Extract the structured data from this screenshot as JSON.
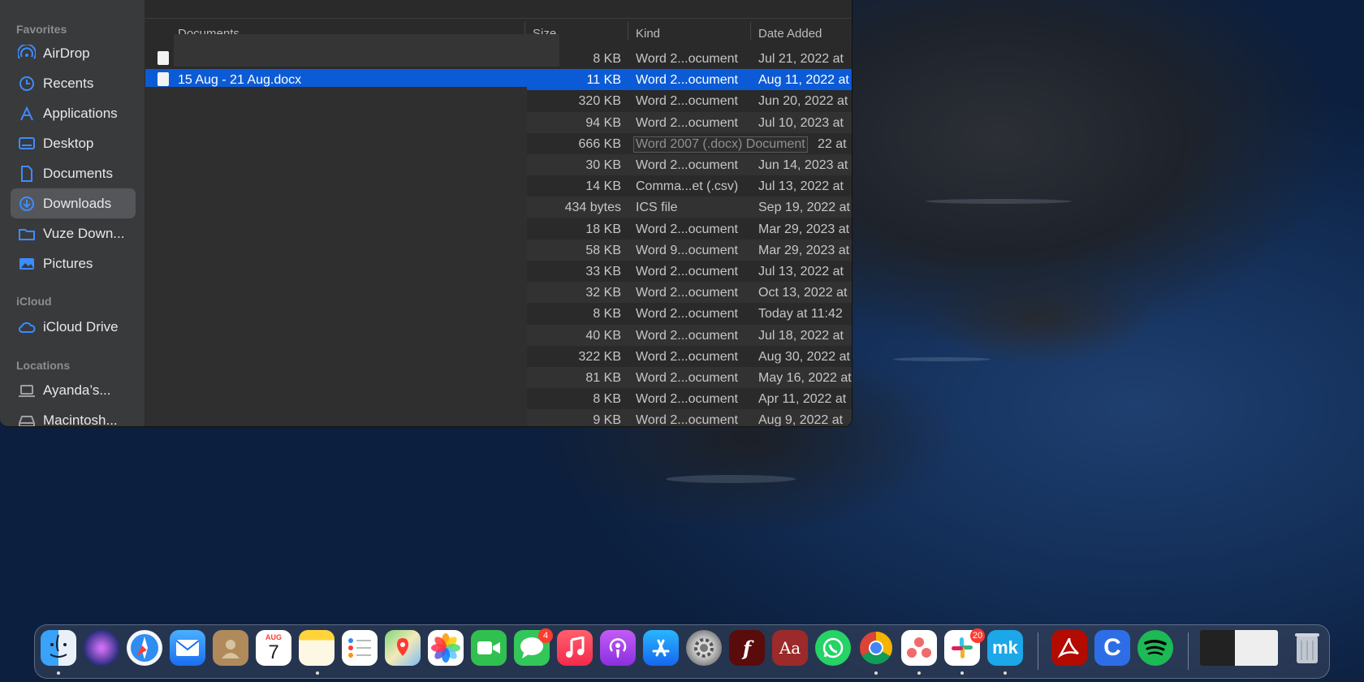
{
  "sidebar": {
    "sections": [
      "Favorites",
      "iCloud",
      "Locations"
    ],
    "favorites": [
      {
        "label": "AirDrop",
        "icon": "airdrop-icon"
      },
      {
        "label": "Recents",
        "icon": "clock-icon"
      },
      {
        "label": "Applications",
        "icon": "applications-icon"
      },
      {
        "label": "Desktop",
        "icon": "desktop-icon"
      },
      {
        "label": "Documents",
        "icon": "document-icon"
      },
      {
        "label": "Downloads",
        "icon": "download-icon",
        "active": true
      },
      {
        "label": "Vuze Down...",
        "icon": "folder-icon"
      },
      {
        "label": "Pictures",
        "icon": "pictures-icon"
      }
    ],
    "icloud": [
      {
        "label": "iCloud Drive",
        "icon": "cloud-icon"
      }
    ],
    "locations": [
      {
        "label": "Ayanda’s...",
        "icon": "laptop-icon"
      },
      {
        "label": "Macintosh...",
        "icon": "disk-icon"
      }
    ]
  },
  "columns": {
    "name": "Documents",
    "size": "Size",
    "kind": "Kind",
    "date": "Date Added"
  },
  "rows": [
    {
      "name": "",
      "size": "8 KB",
      "kind": "Word 2...ocument",
      "date": "Jul 21, 2022 at"
    },
    {
      "name": "15 Aug - 21 Aug.docx",
      "size": "11 KB",
      "kind": "Word 2...ocument",
      "date": "Aug 11, 2022 at",
      "selected": true
    },
    {
      "name": "",
      "size": "320 KB",
      "kind": "Word 2...ocument",
      "date": "Jun 20, 2022 at"
    },
    {
      "name": "",
      "size": "94 KB",
      "kind": "Word 2...ocument",
      "date": "Jul 10, 2023 at"
    },
    {
      "name": "",
      "size": "666 KB",
      "kind": "Word 2007 (.docx) Document",
      "date": "22 at",
      "editing": true
    },
    {
      "name": "",
      "size": "30 KB",
      "kind": "Word 2...ocument",
      "date": "Jun 14, 2023 at"
    },
    {
      "name": "",
      "size": "14 KB",
      "kind": "Comma...et (.csv)",
      "date": "Jul 13, 2022 at"
    },
    {
      "name": "",
      "size": "434 bytes",
      "kind": "ICS file",
      "date": "Sep 19, 2022 at"
    },
    {
      "name": "",
      "size": "18 KB",
      "kind": "Word 2...ocument",
      "date": "Mar 29, 2023 at"
    },
    {
      "name": "",
      "size": "58 KB",
      "kind": "Word 9...ocument",
      "date": "Mar 29, 2023 at"
    },
    {
      "name": "",
      "size": "33 KB",
      "kind": "Word 2...ocument",
      "date": "Jul 13, 2022 at"
    },
    {
      "name": "",
      "size": "32 KB",
      "kind": "Word 2...ocument",
      "date": "Oct 13, 2022 at"
    },
    {
      "name": "",
      "size": "8 KB",
      "kind": "Word 2...ocument",
      "date": "Today at 11:42"
    },
    {
      "name": "",
      "size": "40 KB",
      "kind": "Word 2...ocument",
      "date": "Jul 18, 2022 at"
    },
    {
      "name": "",
      "size": "322 KB",
      "kind": "Word 2...ocument",
      "date": "Aug 30, 2022 at"
    },
    {
      "name": "",
      "size": "81 KB",
      "kind": "Word 2...ocument",
      "date": "May 16, 2022 at"
    },
    {
      "name": "",
      "size": "8 KB",
      "kind": "Word 2...ocument",
      "date": "Apr 11, 2022 at"
    },
    {
      "name": "",
      "size": "9 KB",
      "kind": "Word 2...ocument",
      "date": "Aug 9, 2022 at"
    }
  ],
  "dock": {
    "calendar_month": "AUG",
    "calendar_day": "7",
    "messages_badge": "4",
    "slack_badge": "20",
    "dictionary_glyph": "Aa",
    "items": [
      "finder-icon",
      "siri-icon",
      "safari-icon",
      "mail-icon",
      "contacts-icon",
      "calendar-icon",
      "notes-icon",
      "reminders-icon",
      "maps-icon",
      "photos-icon",
      "facetime-icon",
      "messages-icon",
      "music-icon",
      "podcasts-icon",
      "app-store-icon",
      "system-preferences-icon",
      "flash-icon",
      "dictionary-icon",
      "whatsapp-icon",
      "chrome-icon",
      "asana-icon",
      "slack-icon",
      "mk-icon",
      "acrobat-icon",
      "ccleaner-icon",
      "spotify-icon",
      "window-preview-icon",
      "trash-icon"
    ]
  }
}
